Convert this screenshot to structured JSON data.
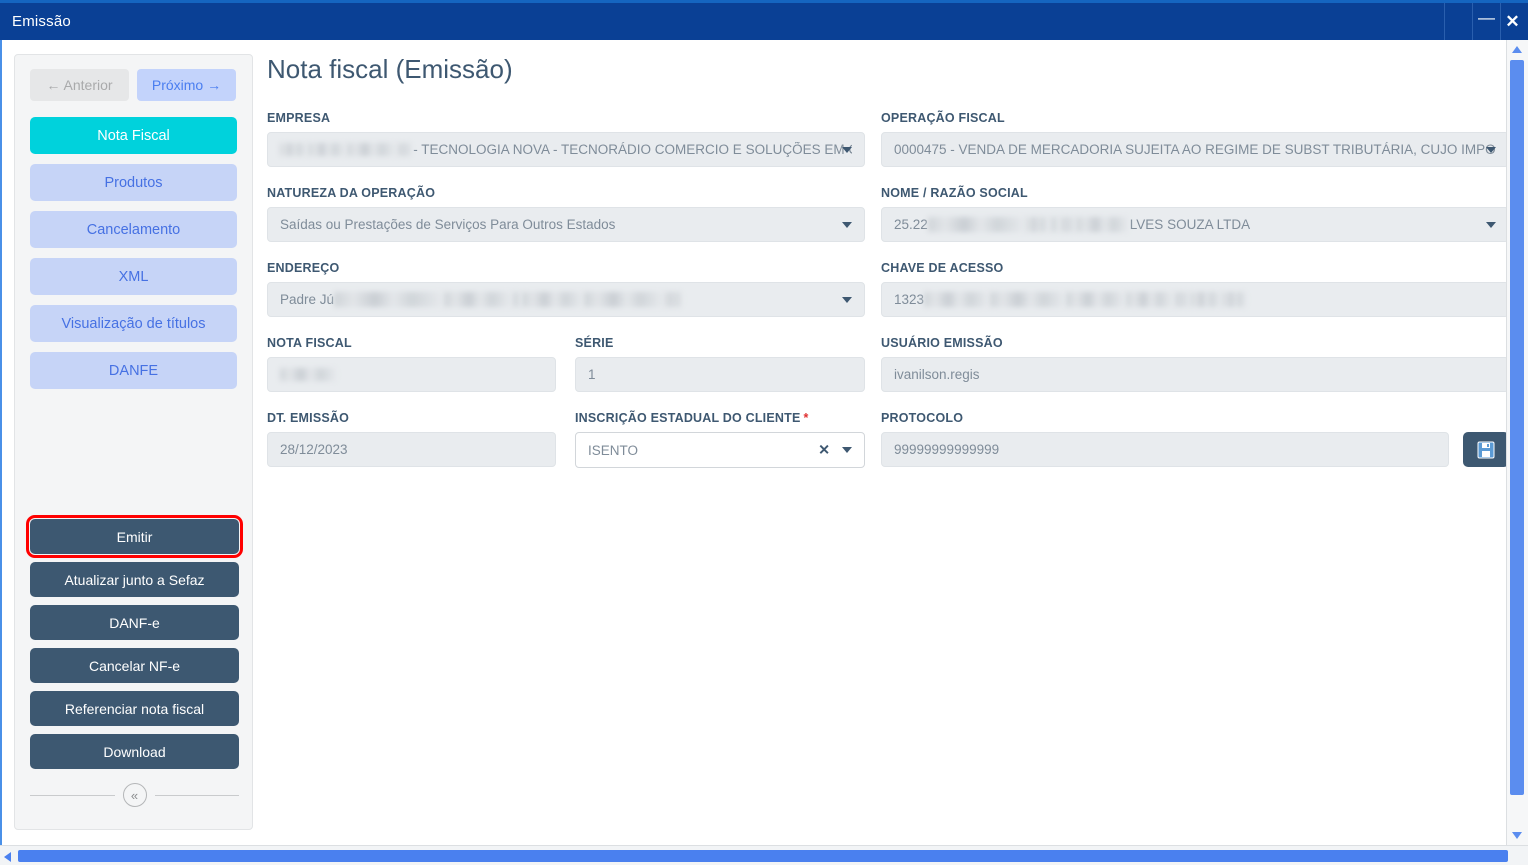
{
  "window": {
    "title": "Emissão",
    "minimize_label": "—",
    "close_label": "✕"
  },
  "colors": {
    "titlebar": "#0a4095",
    "active_nav": "#00d2dc",
    "nav_item": "#c6d4f7",
    "action_button": "#3d5871",
    "highlight_outline": "#ff0000",
    "label_text": "#3e5871",
    "scrollbar": "#4a80ef"
  },
  "sidebar": {
    "pager": {
      "previous_label": "← Anterior",
      "next_label": "Próximo →"
    },
    "items": [
      {
        "label": "Nota Fiscal",
        "active": true
      },
      {
        "label": "Produtos",
        "active": false
      },
      {
        "label": "Cancelamento",
        "active": false
      },
      {
        "label": "XML",
        "active": false
      },
      {
        "label": "Visualização de títulos",
        "active": false
      },
      {
        "label": "DANFE",
        "active": false
      }
    ],
    "actions": [
      {
        "label": "Emitir",
        "highlighted": true
      },
      {
        "label": "Atualizar junto a Sefaz",
        "highlighted": false
      },
      {
        "label": "DANF-e",
        "highlighted": false
      },
      {
        "label": "Cancelar NF-e",
        "highlighted": false
      },
      {
        "label": "Referenciar nota fiscal",
        "highlighted": false
      },
      {
        "label": "Download",
        "highlighted": false
      }
    ],
    "collapse_icon": "«"
  },
  "main": {
    "page_title": "Nota fiscal (Emissão)",
    "fields": {
      "empresa": {
        "label": "EMPRESA",
        "value": " - TECNOLOGIA NOVA - TECNORÁDIO COMERCIO E SOLUÇÕES EM COMU"
      },
      "operacao_fiscal": {
        "label": "OPERAÇÃO FISCAL",
        "value": "0000475 - VENDA DE MERCADORIA SUJEITA AO REGIME DE SUBST TRIBUTÁRIA, CUJO IMPO"
      },
      "natureza_operacao": {
        "label": "NATUREZA DA OPERAÇÃO",
        "value": "Saídas ou Prestações de Serviços Para Outros Estados"
      },
      "nome_razao_social": {
        "label": "NOME / RAZÃO SOCIAL",
        "value_prefix": "25.22",
        "value_suffix": "LVES SOUZA LTDA"
      },
      "endereco": {
        "label": "ENDEREÇO",
        "value_prefix": "Padre Jú"
      },
      "chave_acesso": {
        "label": "CHAVE DE ACESSO",
        "value_prefix": "1323"
      },
      "nota_fiscal": {
        "label": "NOTA FISCAL",
        "value": ""
      },
      "serie": {
        "label": "SÉRIE",
        "value": "1"
      },
      "usuario_emissao": {
        "label": "USUÁRIO EMISSÃO",
        "value": "ivanilson.regis"
      },
      "dt_emissao": {
        "label": "DT. EMISSÃO",
        "value": "28/12/2023"
      },
      "inscricao_estadual": {
        "label": "INSCRIÇÃO ESTADUAL DO CLIENTE",
        "required_marker": "*",
        "value": "ISENTO",
        "clear_icon": "✕"
      },
      "protocolo": {
        "label": "PROTOCOLO",
        "value": "99999999999999"
      }
    }
  }
}
